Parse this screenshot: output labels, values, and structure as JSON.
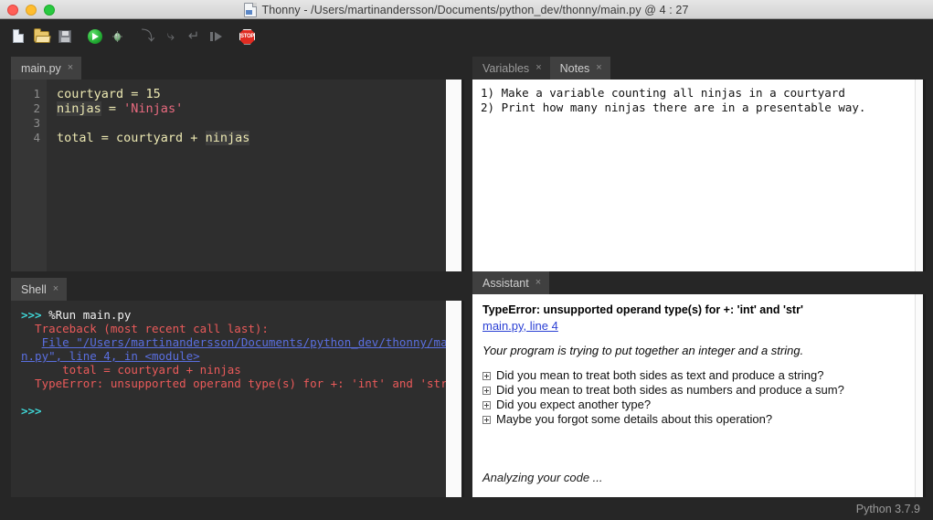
{
  "window": {
    "title": "Thonny  -  /Users/martinandersson/Documents/python_dev/thonny/main.py @ 4 : 27",
    "doc_icon": "document-icon",
    "traffic_lights": [
      "close",
      "minimize",
      "maximize"
    ]
  },
  "toolbar": {
    "buttons": [
      {
        "name": "new-file",
        "icon": "new-file-icon",
        "label": "New"
      },
      {
        "name": "open-file",
        "icon": "open-folder-icon",
        "label": "Load"
      },
      {
        "name": "save-file",
        "icon": "save-floppy-icon",
        "label": "Save"
      },
      {
        "name": "run-script",
        "icon": "run-play-icon",
        "label": "Run"
      },
      {
        "name": "debug-script",
        "icon": "debug-bug-icon",
        "label": "Debug"
      },
      {
        "name": "step-over",
        "icon": "step-over-icon",
        "label": "Step over"
      },
      {
        "name": "step-into",
        "icon": "step-into-icon",
        "label": "Step into"
      },
      {
        "name": "step-out",
        "icon": "step-out-icon",
        "label": "Step out"
      },
      {
        "name": "resume",
        "icon": "resume-icon",
        "label": "Resume"
      },
      {
        "name": "stop",
        "icon": "stop-sign-icon",
        "label": "STOP"
      }
    ],
    "stop_text": "STOP"
  },
  "editor": {
    "tabs": [
      {
        "label": "main.py",
        "active": true,
        "close": "×"
      }
    ],
    "line_numbers": [
      "1",
      "2",
      "3",
      "4"
    ],
    "code_lines": [
      {
        "n": 1,
        "parts": [
          {
            "t": "courtyard = 15",
            "k": "plain"
          }
        ]
      },
      {
        "n": 2,
        "parts": [
          {
            "t": "ninjas",
            "k": "hl"
          },
          {
            "t": " = ",
            "k": "plain"
          },
          {
            "t": "'Ninjas'",
            "k": "str"
          }
        ]
      },
      {
        "n": 3,
        "parts": [
          {
            "t": "",
            "k": "plain"
          }
        ]
      },
      {
        "n": 4,
        "parts": [
          {
            "t": "total = courtyard + ",
            "k": "plain"
          },
          {
            "t": "ninjas",
            "k": "hl"
          }
        ]
      }
    ]
  },
  "shell": {
    "tabs": [
      {
        "label": "Shell",
        "active": true,
        "close": "×"
      }
    ],
    "lines": [
      {
        "segments": [
          {
            "t": ">>> ",
            "k": "prompt"
          },
          {
            "t": "%Run main.py",
            "k": "cmd"
          }
        ]
      },
      {
        "segments": [
          {
            "t": "  Traceback (most recent call last):",
            "k": "err"
          }
        ]
      },
      {
        "segments": [
          {
            "t": "   ",
            "k": "err"
          },
          {
            "t": "File \"/Users/martinandersson/Documents/python_dev/thonny/mai",
            "k": "link"
          }
        ]
      },
      {
        "segments": [
          {
            "t": "n.py\", line 4, in <module>",
            "k": "link"
          }
        ]
      },
      {
        "segments": [
          {
            "t": "      total = courtyard + ninjas",
            "k": "err"
          }
        ]
      },
      {
        "segments": [
          {
            "t": "  TypeError: unsupported operand type(s) for +: 'int' and 'str'",
            "k": "err"
          }
        ]
      },
      {
        "segments": [
          {
            "t": "",
            "k": "err"
          }
        ]
      },
      {
        "segments": [
          {
            "t": ">>>",
            "k": "prompt"
          }
        ]
      }
    ]
  },
  "notes": {
    "tabs": [
      {
        "label": "Variables",
        "active": false,
        "close": "×"
      },
      {
        "label": "Notes",
        "active": true,
        "close": "×"
      }
    ],
    "lines": [
      "1) Make a variable counting all ninjas in a courtyard",
      "2) Print how many ninjas there are in a presentable way."
    ]
  },
  "assistant": {
    "tabs": [
      {
        "label": "Assistant",
        "active": true,
        "close": "×"
      }
    ],
    "error_title": "TypeError: unsupported operand type(s) for +: 'int' and 'str'",
    "error_link": "main.py, line 4",
    "description": "Your program is trying to put together an integer and a string.",
    "suggestions": [
      "Did you mean to treat both sides as text and produce a string?",
      "Did you mean to treat both sides as numbers and produce a sum?",
      "Did you expect another type?",
      "Maybe you forgot some details about this operation?"
    ],
    "status": "Analyzing your code ..."
  },
  "statusbar": {
    "python_version": "Python 3.7.9"
  },
  "colors": {
    "window_bg": "#262626",
    "panel_dark": "#2e2e2e",
    "tab_active": "#404040",
    "tab_inactive": "#303030",
    "code_text": "#ece8b2",
    "code_string": "#e86a7f",
    "shell_prompt": "#3fd5d5",
    "shell_error": "#ea5a5a",
    "shell_link": "#5a6fe0",
    "assistant_link": "#2a3fd4",
    "run_green": "#27b137",
    "stop_red": "#e02c22"
  }
}
